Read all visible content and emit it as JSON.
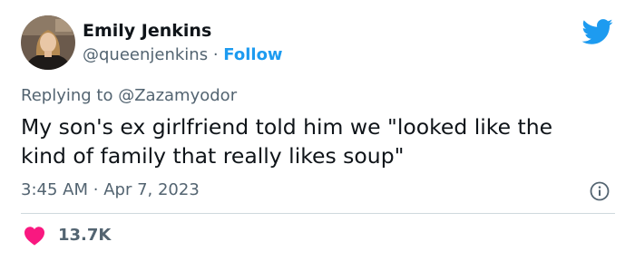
{
  "author": {
    "display_name": "Emily Jenkins",
    "handle": "@queenjenkins",
    "separator": "·",
    "follow_label": "Follow"
  },
  "reply": {
    "prefix": "Replying to",
    "handle": "@Zazamyodor"
  },
  "tweet": {
    "text": "My son's ex girlfriend told him we \"looked like the\nkind of family that really likes soup\""
  },
  "meta": {
    "time": "3:45 AM",
    "separator": "·",
    "date": "Apr 7, 2023"
  },
  "engagement": {
    "likes": "13.7K"
  },
  "icons": {
    "brand": "twitter-bird-icon",
    "info": "info-icon",
    "like": "heart-icon"
  },
  "colors": {
    "accent": "#1d9bf0",
    "like": "#f91880",
    "secondary_text": "#536471",
    "primary_text": "#0f1419",
    "divider": "#cfd9de"
  }
}
